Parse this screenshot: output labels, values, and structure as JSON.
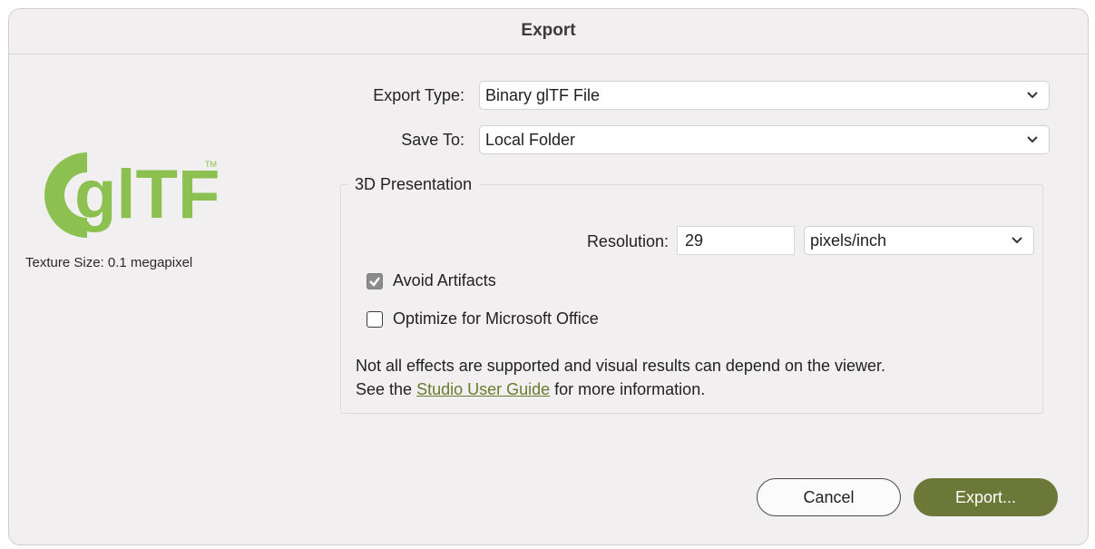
{
  "window": {
    "title": "Export"
  },
  "sidebar": {
    "logo_text": "glTF",
    "logo_tm": "TM",
    "texture_size": "Texture Size: 0.1 megapixel"
  },
  "form": {
    "export_type_label": "Export Type:",
    "export_type_value": "Binary glTF File",
    "save_to_label": "Save To:",
    "save_to_value": "Local Folder"
  },
  "presentation": {
    "group_title": "3D Presentation",
    "resolution_label": "Resolution:",
    "resolution_value": "29",
    "resolution_unit": "pixels/inch",
    "avoid_artifacts_label": "Avoid Artifacts",
    "avoid_artifacts_checked": true,
    "optimize_office_label": "Optimize for Microsoft Office",
    "optimize_office_checked": false,
    "note_line1": "Not all effects are supported and visual results can depend on the viewer.",
    "note_prefix": "See the ",
    "note_link": "Studio User Guide",
    "note_suffix": " for more information."
  },
  "buttons": {
    "cancel": "Cancel",
    "export": "Export..."
  },
  "colors": {
    "accent": "#6c7838",
    "logo_green": "#8cc152",
    "link": "#6a7a2e",
    "window_bg": "#f1efef"
  },
  "icons": {
    "dropdown": "chevron-down-icon",
    "checkmark": "checkmark-icon"
  }
}
